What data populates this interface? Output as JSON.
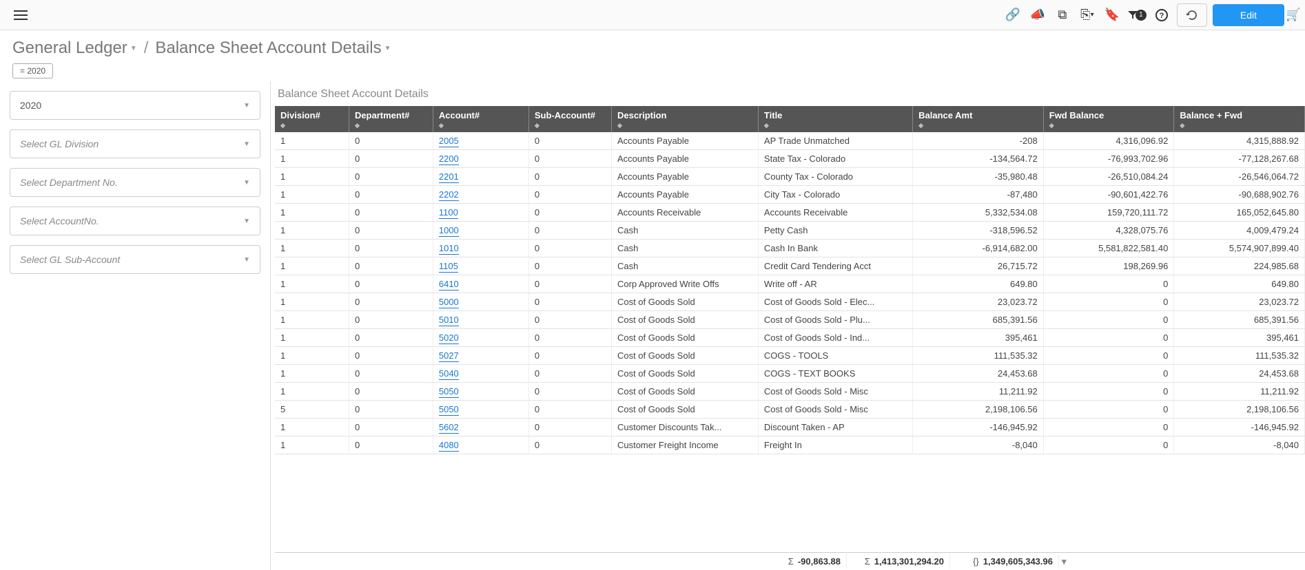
{
  "topbar": {
    "filter_count": "1",
    "edit_label": "Edit"
  },
  "breadcrumb": {
    "crumb1": "General Ledger",
    "crumb2": "Balance Sheet Account Details",
    "year_chip": "= 2020"
  },
  "sidebar": {
    "year": "2020",
    "division_placeholder": "Select GL Division",
    "dept_placeholder": "Select Department No.",
    "account_placeholder": "Select AccountNo.",
    "subaccount_placeholder": "Select GL Sub-Account"
  },
  "report": {
    "title": "Balance Sheet Account Details",
    "columns": [
      "Division#",
      "Department#",
      "Account#",
      "Sub-Account#",
      "Description",
      "Title",
      "Balance Amt",
      "Fwd Balance",
      "Balance + Fwd"
    ],
    "rows": [
      {
        "div": "1",
        "dept": "0",
        "acct": "2005",
        "sub": "0",
        "desc": "Accounts Payable",
        "title": "AP Trade Unmatched",
        "bal": "-208",
        "fwd": "4,316,096.92",
        "bfwd": "4,315,888.92"
      },
      {
        "div": "1",
        "dept": "0",
        "acct": "2200",
        "sub": "0",
        "desc": "Accounts Payable",
        "title": "State Tax - Colorado",
        "bal": "-134,564.72",
        "fwd": "-76,993,702.96",
        "bfwd": "-77,128,267.68"
      },
      {
        "div": "1",
        "dept": "0",
        "acct": "2201",
        "sub": "0",
        "desc": "Accounts Payable",
        "title": "County Tax - Colorado",
        "bal": "-35,980.48",
        "fwd": "-26,510,084.24",
        "bfwd": "-26,546,064.72"
      },
      {
        "div": "1",
        "dept": "0",
        "acct": "2202",
        "sub": "0",
        "desc": "Accounts Payable",
        "title": "City Tax - Colorado",
        "bal": "-87,480",
        "fwd": "-90,601,422.76",
        "bfwd": "-90,688,902.76"
      },
      {
        "div": "1",
        "dept": "0",
        "acct": "1100",
        "sub": "0",
        "desc": "Accounts Receivable",
        "title": "Accounts Receivable",
        "bal": "5,332,534.08",
        "fwd": "159,720,111.72",
        "bfwd": "165,052,645.80"
      },
      {
        "div": "1",
        "dept": "0",
        "acct": "1000",
        "sub": "0",
        "desc": "Cash",
        "title": "Petty Cash",
        "bal": "-318,596.52",
        "fwd": "4,328,075.76",
        "bfwd": "4,009,479.24"
      },
      {
        "div": "1",
        "dept": "0",
        "acct": "1010",
        "sub": "0",
        "desc": "Cash",
        "title": "Cash In Bank",
        "bal": "-6,914,682.00",
        "fwd": "5,581,822,581.40",
        "bfwd": "5,574,907,899.40"
      },
      {
        "div": "1",
        "dept": "0",
        "acct": "1105",
        "sub": "0",
        "desc": "Cash",
        "title": "Credit Card Tendering Acct",
        "bal": "26,715.72",
        "fwd": "198,269.96",
        "bfwd": "224,985.68"
      },
      {
        "div": "1",
        "dept": "0",
        "acct": "6410",
        "sub": "0",
        "desc": "Corp Approved Write Offs",
        "title": "Write off - AR",
        "bal": "649.80",
        "fwd": "0",
        "bfwd": "649.80"
      },
      {
        "div": "1",
        "dept": "0",
        "acct": "5000",
        "sub": "0",
        "desc": "Cost of Goods Sold",
        "title": "Cost of Goods Sold - Elec...",
        "bal": "23,023.72",
        "fwd": "0",
        "bfwd": "23,023.72"
      },
      {
        "div": "1",
        "dept": "0",
        "acct": "5010",
        "sub": "0",
        "desc": "Cost of Goods Sold",
        "title": "Cost of Goods Sold - Plu...",
        "bal": "685,391.56",
        "fwd": "0",
        "bfwd": "685,391.56"
      },
      {
        "div": "1",
        "dept": "0",
        "acct": "5020",
        "sub": "0",
        "desc": "Cost of Goods Sold",
        "title": "Cost of Goods Sold - Ind...",
        "bal": "395,461",
        "fwd": "0",
        "bfwd": "395,461"
      },
      {
        "div": "1",
        "dept": "0",
        "acct": "5027",
        "sub": "0",
        "desc": "Cost of Goods Sold",
        "title": "COGS - TOOLS",
        "bal": "111,535.32",
        "fwd": "0",
        "bfwd": "111,535.32"
      },
      {
        "div": "1",
        "dept": "0",
        "acct": "5040",
        "sub": "0",
        "desc": "Cost of Goods Sold",
        "title": "COGS - TEXT BOOKS",
        "bal": "24,453.68",
        "fwd": "0",
        "bfwd": "24,453.68"
      },
      {
        "div": "1",
        "dept": "0",
        "acct": "5050",
        "sub": "0",
        "desc": "Cost of Goods Sold",
        "title": "Cost of Goods Sold - Misc",
        "bal": "11,211.92",
        "fwd": "0",
        "bfwd": "11,211.92"
      },
      {
        "div": "5",
        "dept": "0",
        "acct": "5050",
        "sub": "0",
        "desc": "Cost of Goods Sold",
        "title": "Cost of Goods Sold - Misc",
        "bal": "2,198,106.56",
        "fwd": "0",
        "bfwd": "2,198,106.56"
      },
      {
        "div": "1",
        "dept": "0",
        "acct": "5602",
        "sub": "0",
        "desc": "Customer Discounts Tak...",
        "title": "Discount Taken - AP",
        "bal": "-146,945.92",
        "fwd": "0",
        "bfwd": "-146,945.92"
      },
      {
        "div": "1",
        "dept": "0",
        "acct": "4080",
        "sub": "0",
        "desc": "Customer Freight Income",
        "title": "Freight In",
        "bal": "-8,040",
        "fwd": "0",
        "bfwd": "-8,040"
      }
    ],
    "summary": {
      "bal": "-90,863.88",
      "fwd": "1,413,301,294.20",
      "bfwd": "1,349,605,343.96"
    }
  }
}
